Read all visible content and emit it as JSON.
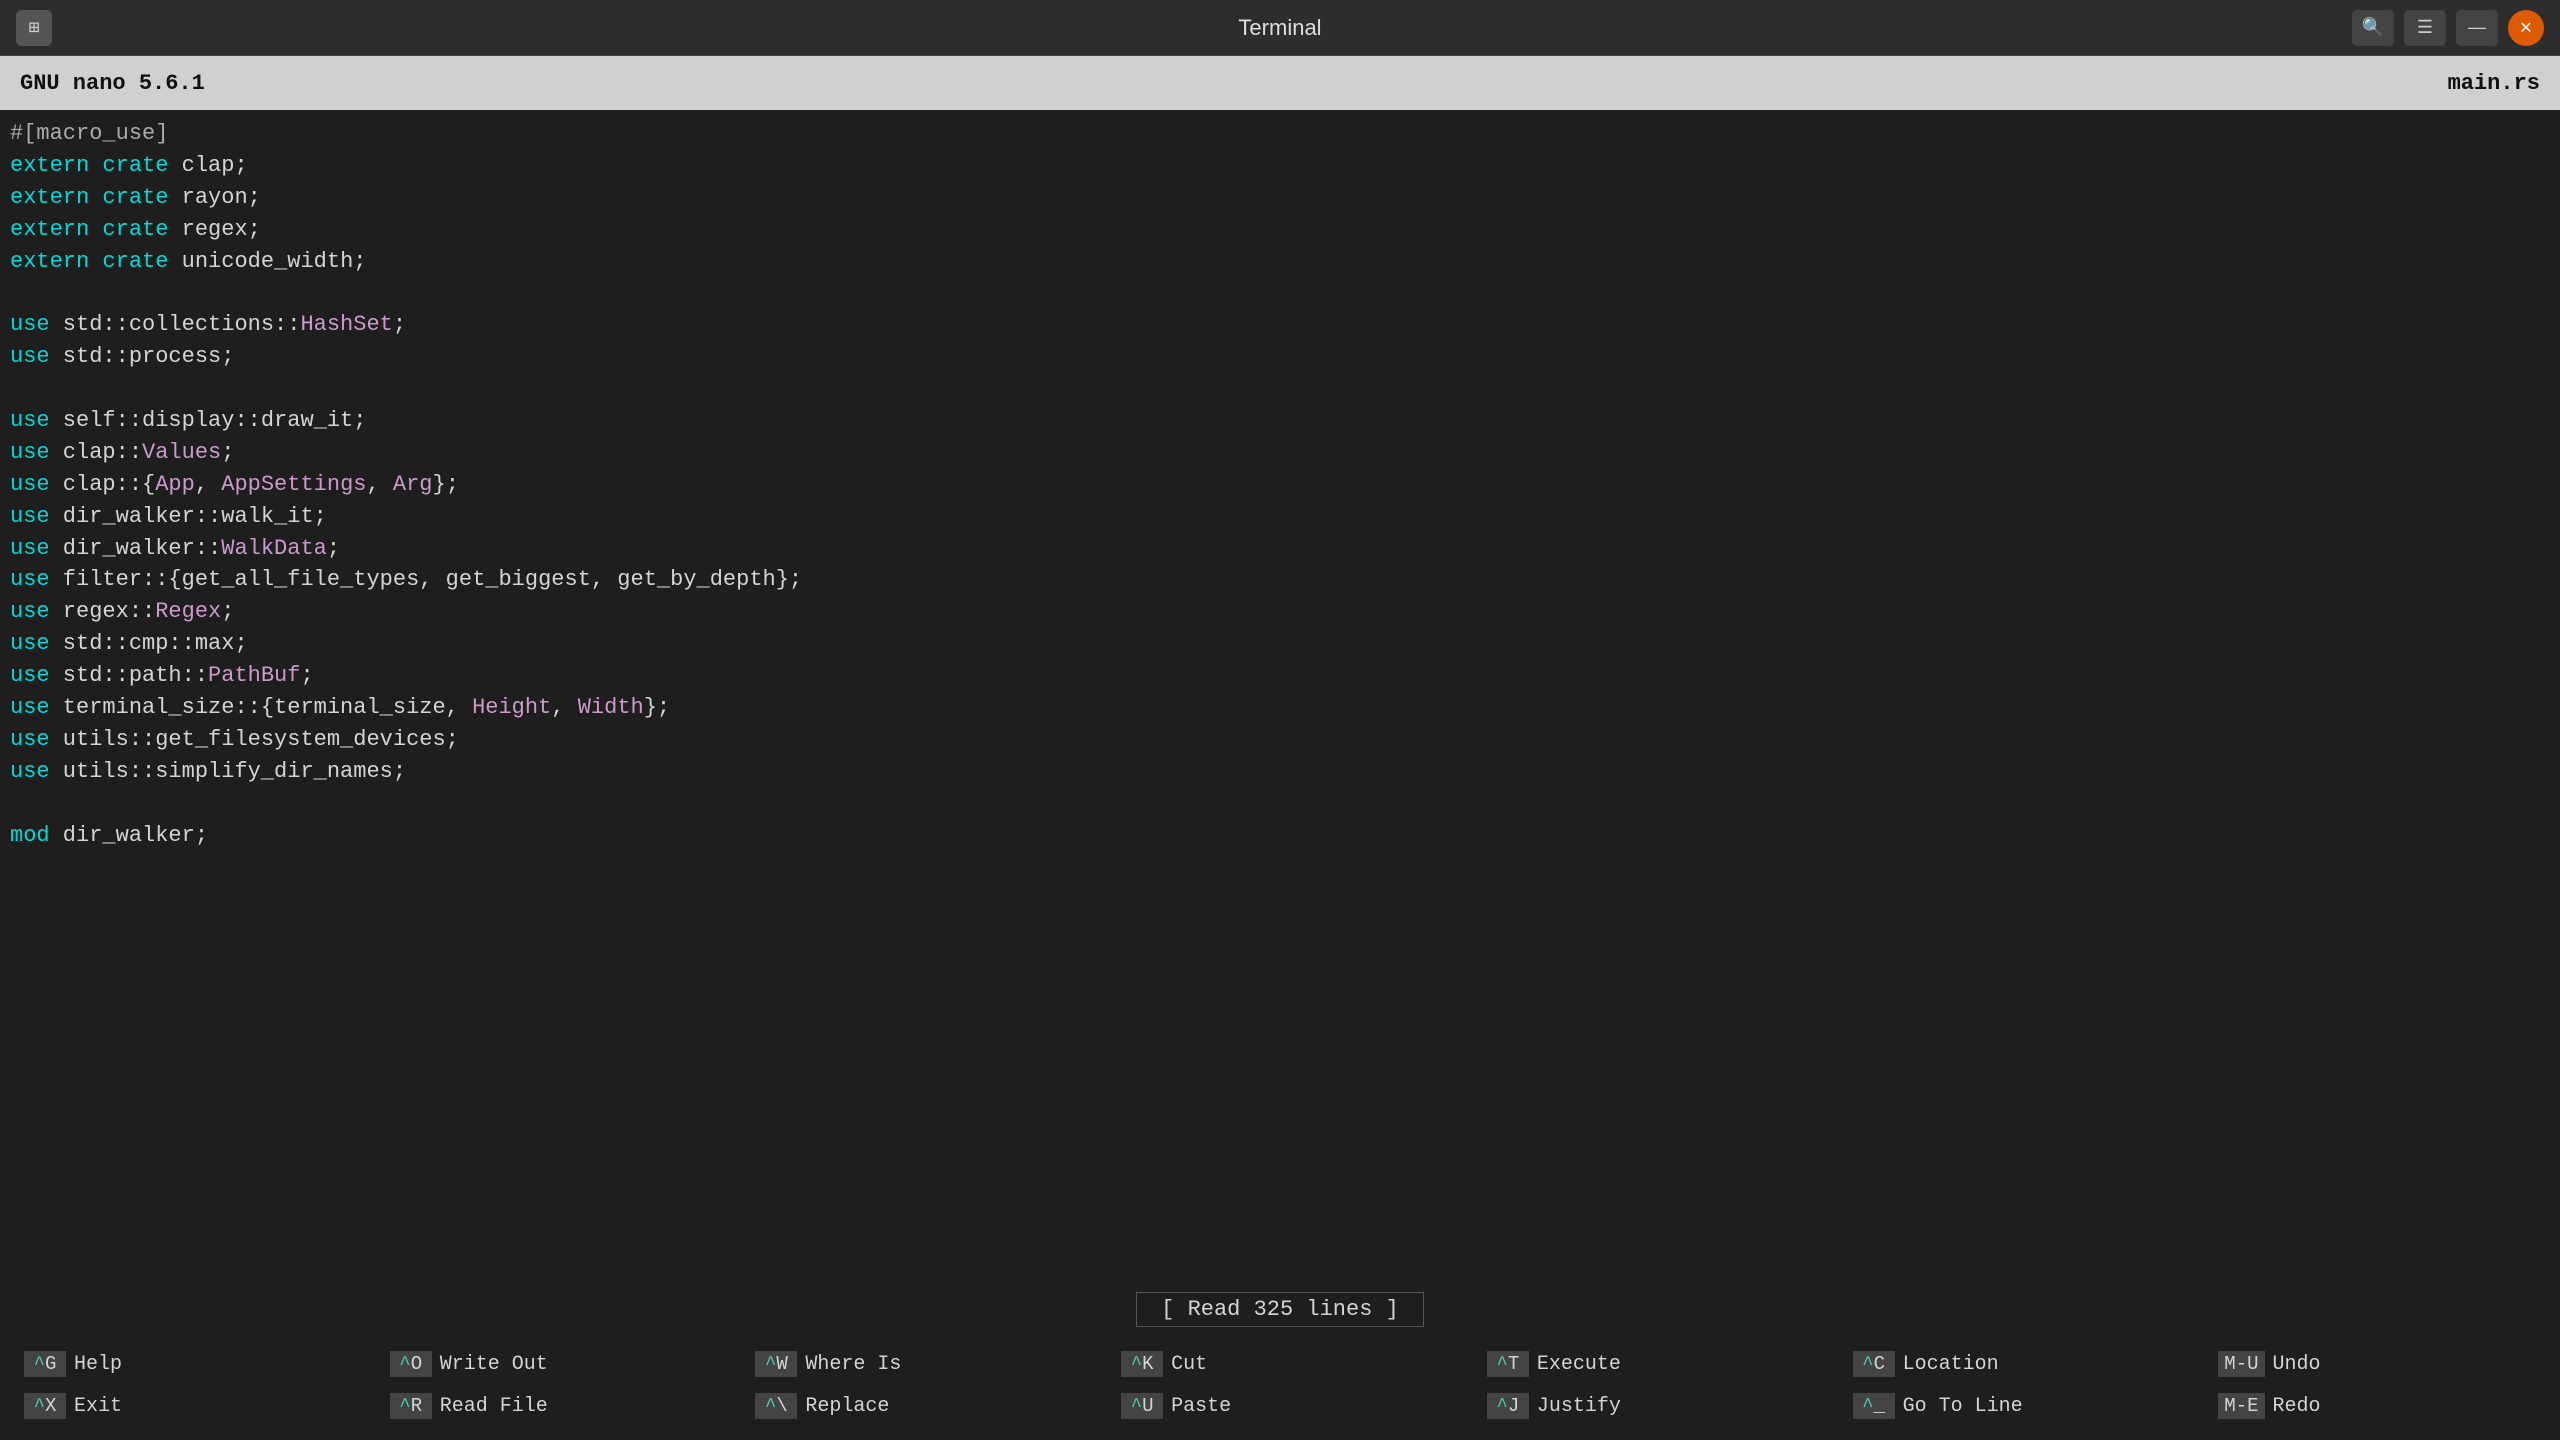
{
  "titlebar": {
    "title": "Terminal",
    "app_icon": "⊞"
  },
  "nano_header": {
    "version": "GNU nano 5.6.1",
    "filename": "main.rs"
  },
  "editor": {
    "lines": [
      {
        "text": "#[macro_use]",
        "parts": [
          {
            "text": "#[macro_use]",
            "class": "c-hash"
          }
        ]
      },
      {
        "text": "extern crate clap;",
        "parts": [
          {
            "text": "extern",
            "class": "c-cyan"
          },
          {
            "text": " ",
            "class": "c-white"
          },
          {
            "text": "crate",
            "class": "c-cyan"
          },
          {
            "text": " clap;",
            "class": "c-white"
          }
        ]
      },
      {
        "text": "extern crate rayon;",
        "parts": [
          {
            "text": "extern",
            "class": "c-cyan"
          },
          {
            "text": " ",
            "class": "c-white"
          },
          {
            "text": "crate",
            "class": "c-cyan"
          },
          {
            "text": " rayon;",
            "class": "c-white"
          }
        ]
      },
      {
        "text": "extern crate regex;",
        "parts": [
          {
            "text": "extern",
            "class": "c-cyan"
          },
          {
            "text": " ",
            "class": "c-white"
          },
          {
            "text": "crate",
            "class": "c-cyan"
          },
          {
            "text": " regex;",
            "class": "c-white"
          }
        ]
      },
      {
        "text": "extern crate unicode_width;",
        "parts": [
          {
            "text": "extern",
            "class": "c-cyan"
          },
          {
            "text": " ",
            "class": "c-white"
          },
          {
            "text": "crate",
            "class": "c-cyan"
          },
          {
            "text": " unicode_width;",
            "class": "c-white"
          }
        ]
      },
      {
        "text": "",
        "parts": []
      },
      {
        "text": "use std::collections::HashSet;",
        "parts": [
          {
            "text": "use",
            "class": "c-cyan"
          },
          {
            "text": " std::collections::",
            "class": "c-white"
          },
          {
            "text": "HashSet",
            "class": "c-purple"
          },
          {
            "text": ";",
            "class": "c-white"
          }
        ]
      },
      {
        "text": "use std::process;",
        "parts": [
          {
            "text": "use",
            "class": "c-cyan"
          },
          {
            "text": " std::process;",
            "class": "c-white"
          }
        ]
      },
      {
        "text": "",
        "parts": []
      },
      {
        "text": "use self::display::draw_it;",
        "parts": [
          {
            "text": "use",
            "class": "c-cyan"
          },
          {
            "text": " self::display::draw_it;",
            "class": "c-white"
          }
        ]
      },
      {
        "text": "use clap::Values;",
        "parts": [
          {
            "text": "use",
            "class": "c-cyan"
          },
          {
            "text": " clap::",
            "class": "c-white"
          },
          {
            "text": "Values",
            "class": "c-purple"
          },
          {
            "text": ";",
            "class": "c-white"
          }
        ]
      },
      {
        "text": "use clap::{App, AppSettings, Arg};",
        "parts": [
          {
            "text": "use",
            "class": "c-cyan"
          },
          {
            "text": " clap::{",
            "class": "c-white"
          },
          {
            "text": "App",
            "class": "c-purple"
          },
          {
            "text": ", ",
            "class": "c-white"
          },
          {
            "text": "AppSettings",
            "class": "c-purple"
          },
          {
            "text": ", ",
            "class": "c-white"
          },
          {
            "text": "Arg",
            "class": "c-purple"
          },
          {
            "text": "};",
            "class": "c-white"
          }
        ]
      },
      {
        "text": "use dir_walker::walk_it;",
        "parts": [
          {
            "text": "use",
            "class": "c-cyan"
          },
          {
            "text": " dir_walker::walk_it;",
            "class": "c-white"
          }
        ]
      },
      {
        "text": "use dir_walker::WalkData;",
        "parts": [
          {
            "text": "use",
            "class": "c-cyan"
          },
          {
            "text": " dir_walker::",
            "class": "c-white"
          },
          {
            "text": "WalkData",
            "class": "c-purple"
          },
          {
            "text": ";",
            "class": "c-white"
          }
        ]
      },
      {
        "text": "use filter::{get_all_file_types, get_biggest, get_by_depth};",
        "parts": [
          {
            "text": "use",
            "class": "c-cyan"
          },
          {
            "text": " filter::{get_all_file_types, get_biggest, get_by_depth};",
            "class": "c-white"
          }
        ]
      },
      {
        "text": "use regex::Regex;",
        "parts": [
          {
            "text": "use",
            "class": "c-cyan"
          },
          {
            "text": " regex::",
            "class": "c-white"
          },
          {
            "text": "Regex",
            "class": "c-purple"
          },
          {
            "text": ";",
            "class": "c-white"
          }
        ]
      },
      {
        "text": "use std::cmp::max;",
        "parts": [
          {
            "text": "use",
            "class": "c-cyan"
          },
          {
            "text": " std::cmp::max;",
            "class": "c-white"
          }
        ]
      },
      {
        "text": "use std::path::PathBuf;",
        "parts": [
          {
            "text": "use",
            "class": "c-cyan"
          },
          {
            "text": " std::path::",
            "class": "c-white"
          },
          {
            "text": "PathBuf",
            "class": "c-purple"
          },
          {
            "text": ";",
            "class": "c-white"
          }
        ]
      },
      {
        "text": "use terminal_size::{terminal_size, Height, Width};",
        "parts": [
          {
            "text": "use",
            "class": "c-cyan"
          },
          {
            "text": " terminal_size::{terminal_size, ",
            "class": "c-white"
          },
          {
            "text": "Height",
            "class": "c-purple"
          },
          {
            "text": ", ",
            "class": "c-white"
          },
          {
            "text": "Width",
            "class": "c-purple"
          },
          {
            "text": "};",
            "class": "c-white"
          }
        ]
      },
      {
        "text": "use utils::get_filesystem_devices;",
        "parts": [
          {
            "text": "use",
            "class": "c-cyan"
          },
          {
            "text": " utils::get_filesystem_devices;",
            "class": "c-white"
          }
        ]
      },
      {
        "text": "use utils::simplify_dir_names;",
        "parts": [
          {
            "text": "use",
            "class": "c-cyan"
          },
          {
            "text": " utils::simplify_dir_names;",
            "class": "c-white"
          }
        ]
      },
      {
        "text": "",
        "parts": []
      },
      {
        "text": "mod dir_walker;",
        "parts": [
          {
            "text": "mod",
            "class": "c-cyan"
          },
          {
            "text": " dir_walker;",
            "class": "c-white"
          }
        ]
      }
    ]
  },
  "status": {
    "message": "[ Read 325 lines ]"
  },
  "shortcuts": [
    [
      {
        "key": "^G",
        "label": "Help"
      },
      {
        "key": "^X",
        "label": "Exit"
      }
    ],
    [
      {
        "key": "^O",
        "label": "Write Out"
      },
      {
        "key": "^R",
        "label": "Read File"
      }
    ],
    [
      {
        "key": "^W",
        "label": "Where Is"
      },
      {
        "key": "^\\",
        "label": "Replace"
      }
    ],
    [
      {
        "key": "^K",
        "label": "Cut"
      },
      {
        "key": "^U",
        "label": "Paste"
      }
    ],
    [
      {
        "key": "^T",
        "label": "Execute"
      },
      {
        "key": "^J",
        "label": "Justify"
      }
    ],
    [
      {
        "key": "^C",
        "label": "Location"
      },
      {
        "key": "^_",
        "label": "Go To Line"
      }
    ],
    [
      {
        "key": "M-U",
        "label": "Undo"
      },
      {
        "key": "M-E",
        "label": "Redo"
      }
    ]
  ]
}
